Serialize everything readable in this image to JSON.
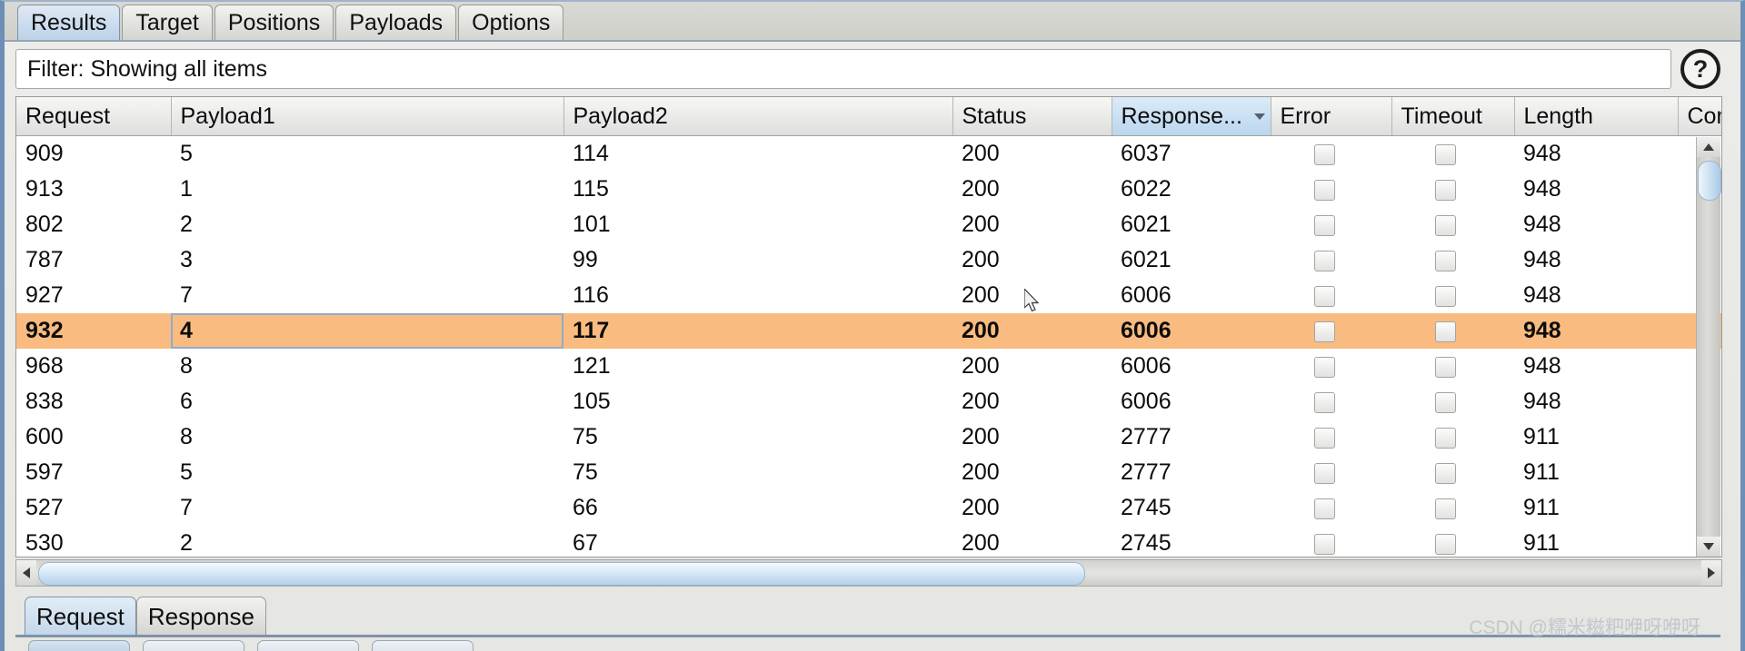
{
  "window": {
    "top_tabs": [
      {
        "label": "Results",
        "active": true
      },
      {
        "label": "Target",
        "active": false
      },
      {
        "label": "Positions",
        "active": false
      },
      {
        "label": "Payloads",
        "active": false
      },
      {
        "label": "Options",
        "active": false
      }
    ]
  },
  "filter": {
    "text": "Filter: Showing all items",
    "help_icon": "question-mark-icon",
    "help_label": "?"
  },
  "table": {
    "columns": [
      {
        "key": "request",
        "label": "Request",
        "sorted": false
      },
      {
        "key": "payload1",
        "label": "Payload1",
        "sorted": false
      },
      {
        "key": "payload2",
        "label": "Payload2",
        "sorted": false
      },
      {
        "key": "status",
        "label": "Status",
        "sorted": false
      },
      {
        "key": "response",
        "label": "Response...",
        "sorted": true
      },
      {
        "key": "error",
        "label": "Error",
        "sorted": false
      },
      {
        "key": "timeout",
        "label": "Timeout",
        "sorted": false
      },
      {
        "key": "length",
        "label": "Length",
        "sorted": false
      },
      {
        "key": "comment",
        "label": "Com",
        "sorted": false
      }
    ],
    "rows": [
      {
        "request": "909",
        "payload1": "5",
        "payload2": "114",
        "status": "200",
        "response": "6037",
        "error": false,
        "timeout": false,
        "length": "948",
        "comment": "",
        "selected": false
      },
      {
        "request": "913",
        "payload1": "1",
        "payload2": "115",
        "status": "200",
        "response": "6022",
        "error": false,
        "timeout": false,
        "length": "948",
        "comment": "",
        "selected": false
      },
      {
        "request": "802",
        "payload1": "2",
        "payload2": "101",
        "status": "200",
        "response": "6021",
        "error": false,
        "timeout": false,
        "length": "948",
        "comment": "",
        "selected": false
      },
      {
        "request": "787",
        "payload1": "3",
        "payload2": "99",
        "status": "200",
        "response": "6021",
        "error": false,
        "timeout": false,
        "length": "948",
        "comment": "",
        "selected": false
      },
      {
        "request": "927",
        "payload1": "7",
        "payload2": "116",
        "status": "200",
        "response": "6006",
        "error": false,
        "timeout": false,
        "length": "948",
        "comment": "",
        "selected": false
      },
      {
        "request": "932",
        "payload1": "4",
        "payload2": "117",
        "status": "200",
        "response": "6006",
        "error": false,
        "timeout": false,
        "length": "948",
        "comment": "",
        "selected": true
      },
      {
        "request": "968",
        "payload1": "8",
        "payload2": "121",
        "status": "200",
        "response": "6006",
        "error": false,
        "timeout": false,
        "length": "948",
        "comment": "",
        "selected": false
      },
      {
        "request": "838",
        "payload1": "6",
        "payload2": "105",
        "status": "200",
        "response": "6006",
        "error": false,
        "timeout": false,
        "length": "948",
        "comment": "",
        "selected": false
      },
      {
        "request": "600",
        "payload1": "8",
        "payload2": "75",
        "status": "200",
        "response": "2777",
        "error": false,
        "timeout": false,
        "length": "911",
        "comment": "",
        "selected": false
      },
      {
        "request": "597",
        "payload1": "5",
        "payload2": "75",
        "status": "200",
        "response": "2777",
        "error": false,
        "timeout": false,
        "length": "911",
        "comment": "",
        "selected": false
      },
      {
        "request": "527",
        "payload1": "7",
        "payload2": "66",
        "status": "200",
        "response": "2745",
        "error": false,
        "timeout": false,
        "length": "911",
        "comment": "",
        "selected": false
      },
      {
        "request": "530",
        "payload1": "2",
        "payload2": "67",
        "status": "200",
        "response": "2745",
        "error": false,
        "timeout": false,
        "length": "911",
        "comment": "",
        "selected": false
      }
    ]
  },
  "bottom_tabs": [
    {
      "label": "Request",
      "active": true
    },
    {
      "label": "Response",
      "active": false
    }
  ],
  "watermark": "CSDN @糯米糍粑咿呀咿呀",
  "colors": {
    "selected_row": "#f9bb80",
    "sorted_header": "#b9d6ee",
    "window_border": "#6d8fb5"
  }
}
